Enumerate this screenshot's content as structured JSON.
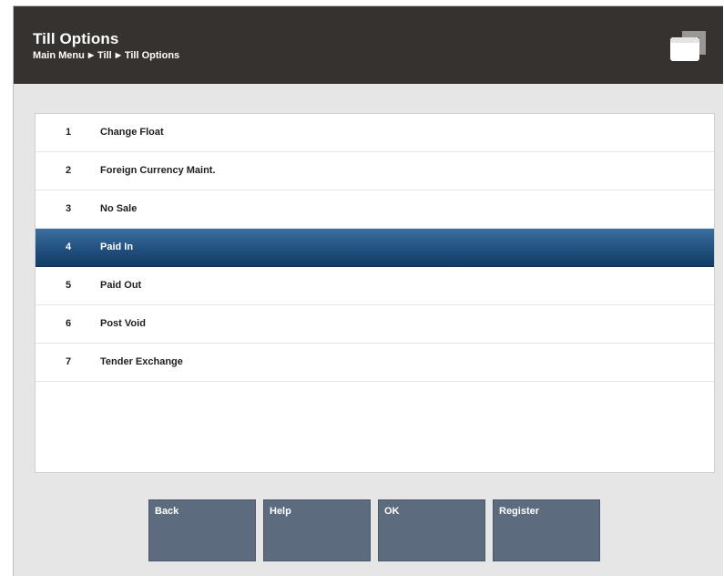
{
  "header": {
    "title": "Till Options",
    "breadcrumb": [
      "Main Menu",
      "Till",
      "Till Options"
    ],
    "icon": "register-drawer-icon"
  },
  "menu": {
    "selected_index": 4,
    "items": [
      {
        "number": "1",
        "label": "Change Float"
      },
      {
        "number": "2",
        "label": "Foreign Currency Maint."
      },
      {
        "number": "3",
        "label": "No Sale"
      },
      {
        "number": "4",
        "label": "Paid In"
      },
      {
        "number": "5",
        "label": "Paid Out"
      },
      {
        "number": "6",
        "label": "Post Void"
      },
      {
        "number": "7",
        "label": "Tender Exchange"
      }
    ]
  },
  "buttons": {
    "back": "Back",
    "help": "Help",
    "ok": "OK",
    "register": "Register"
  },
  "colors": {
    "header_bg": "#363230",
    "selected_row": "#21507f",
    "button_bg": "#5c6b7e"
  }
}
